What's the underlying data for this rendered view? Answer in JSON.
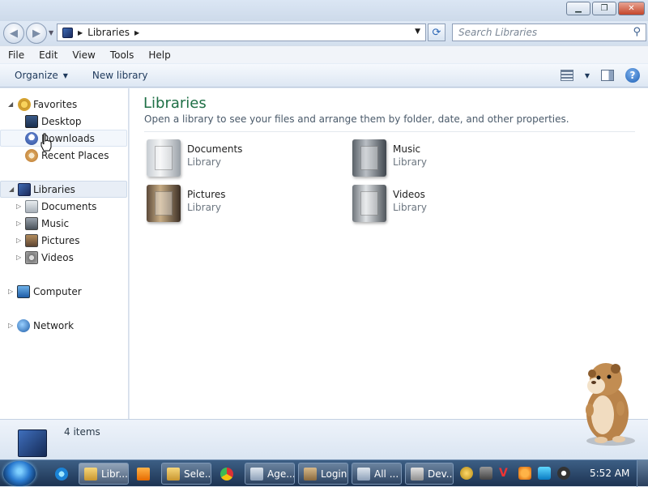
{
  "address": {
    "crumbs": [
      "Libraries"
    ]
  },
  "search": {
    "placeholder": "Search Libraries"
  },
  "menu": [
    "File",
    "Edit",
    "View",
    "Tools",
    "Help"
  ],
  "toolbar": {
    "organize": "Organize",
    "new_library": "New library"
  },
  "nav": {
    "favorites": {
      "label": "Favorites",
      "items": [
        "Desktop",
        "Downloads",
        "Recent Places"
      ]
    },
    "libraries": {
      "label": "Libraries",
      "items": [
        "Documents",
        "Music",
        "Pictures",
        "Videos"
      ]
    },
    "computer": "Computer",
    "network": "Network"
  },
  "content": {
    "title": "Libraries",
    "subtitle": "Open a library to see your files and arrange them by folder, date, and other properties.",
    "libraries": [
      {
        "name": "Documents",
        "type": "Library",
        "icon": "documents-library-icon"
      },
      {
        "name": "Music",
        "type": "Library",
        "icon": "music-library-icon"
      },
      {
        "name": "Pictures",
        "type": "Library",
        "icon": "pictures-library-icon"
      },
      {
        "name": "Videos",
        "type": "Library",
        "icon": "videos-library-icon"
      }
    ]
  },
  "details": {
    "count": "4 items"
  },
  "taskbar": {
    "tasks": [
      "Libr...",
      "Sele...",
      "Age...",
      "Login",
      "All ...",
      "Dev..."
    ],
    "clock": "5:52 AM"
  },
  "colors": {
    "title_green": "#1e6f45",
    "taskbar": "#1d3352",
    "selection": "#e8eef6"
  }
}
